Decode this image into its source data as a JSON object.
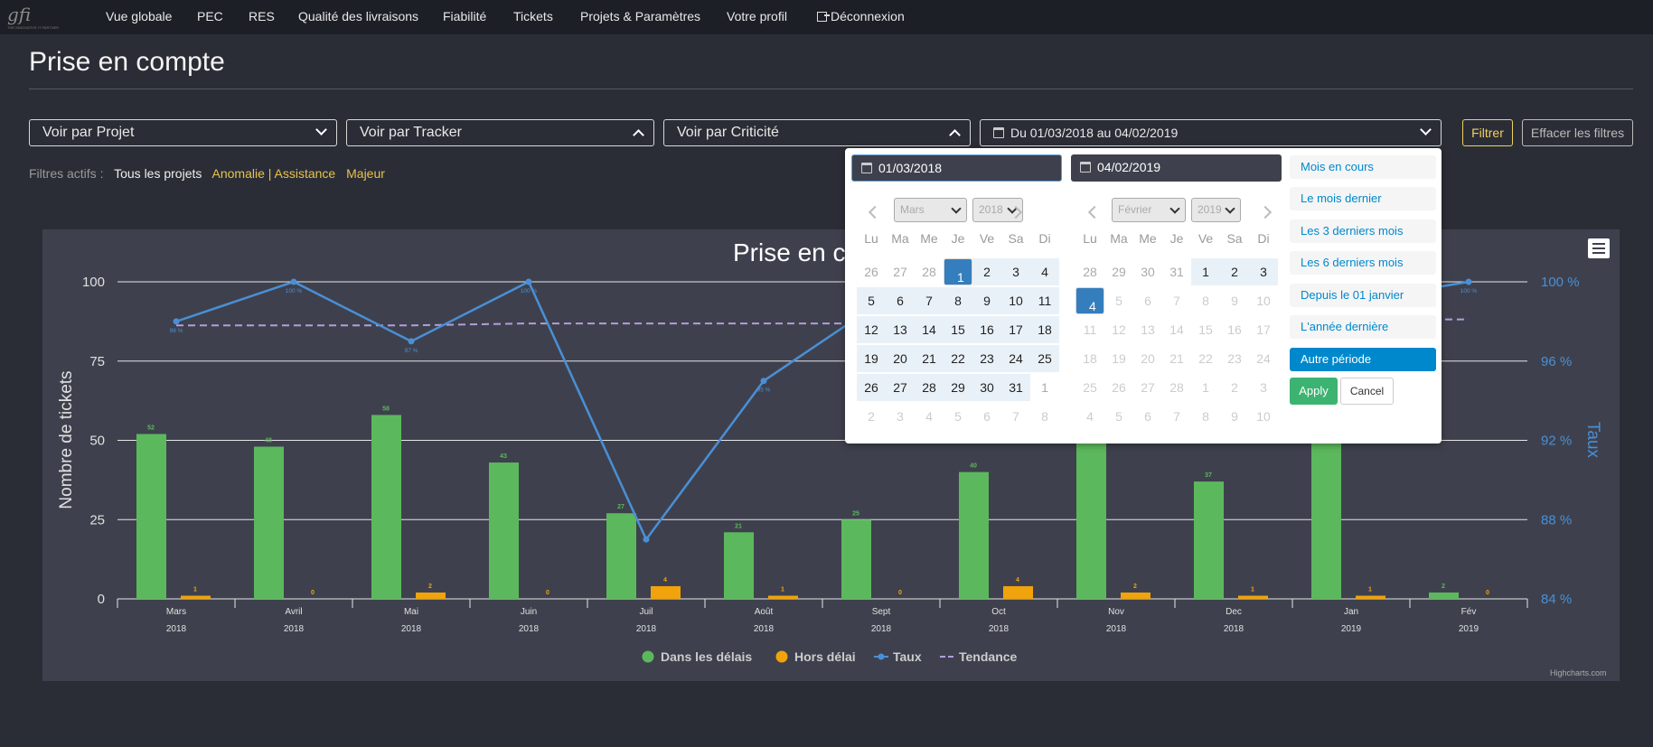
{
  "navbar": {
    "logo_text": "gfi",
    "logo_tagline": "THE INNOVATIVE IT PARTNER",
    "items": [
      "Vue globale",
      "PEC",
      "RES",
      "Qualité des livraisons",
      "Fiabilité",
      "Tickets",
      "Projets & Paramètres",
      "Votre profil",
      "Déconnexion"
    ]
  },
  "page": {
    "title": "Prise en compte"
  },
  "filters": {
    "projet": "Voir par Projet",
    "tracker": "Voir par Tracker",
    "criticite": "Voir par Criticité",
    "date_range": "Du 01/03/2018 au 04/02/2019",
    "filter_button": "Filtrer",
    "clear_button": "Effacer les filtres",
    "active_label": "Filtres actifs :",
    "active": [
      "Tous les projets",
      "Anomalie | Assistance",
      "Majeur"
    ]
  },
  "colors": {
    "green": "#5cb85c",
    "orange": "#f0a30a",
    "blue": "#4a8fd6",
    "trend": "#b39ddb",
    "accent_yellow": "#f0d060"
  },
  "chart_data": {
    "type": "bar",
    "title": "Prise en c",
    "categories": [
      "Mars",
      "Avril",
      "Mai",
      "Juin",
      "Juil",
      "Août",
      "Sept",
      "Oct",
      "Nov",
      "Dec",
      "Jan",
      "Fév"
    ],
    "category_years": [
      "2018",
      "2018",
      "2018",
      "2018",
      "2018",
      "2018",
      "2018",
      "2018",
      "2018",
      "2018",
      "2019",
      "2019"
    ],
    "ylabel": "Nombre de tickets",
    "ylabel_right": "Taux",
    "ylim": [
      0,
      100
    ],
    "yticks": [
      "0",
      "25",
      "50",
      "75",
      "100"
    ],
    "y2ticks": [
      "84 %",
      "88 %",
      "92 %",
      "96 %",
      "100 %"
    ],
    "y2lim": [
      84,
      100
    ],
    "series": [
      {
        "name": "Dans les délais",
        "values": [
          52,
          48,
          58,
          43,
          27,
          21,
          25,
          40,
          55,
          37,
          50,
          2
        ],
        "labels": [
          "52",
          "48",
          "58",
          "43",
          "27",
          "21",
          "25",
          "40",
          "",
          "37",
          "",
          "2"
        ]
      },
      {
        "name": "Hors délai",
        "values": [
          1,
          0,
          2,
          0,
          4,
          1,
          0,
          4,
          2,
          1,
          1,
          0
        ],
        "labels": [
          "1",
          "0",
          "2",
          "0",
          "4",
          "1",
          "0",
          "4",
          "2",
          "1",
          "1",
          "0"
        ]
      },
      {
        "name": "Taux",
        "values": [
          98,
          100,
          97,
          100,
          87,
          95,
          99,
          93,
          100,
          100,
          99,
          100
        ],
        "labels": [
          "98 %",
          "100 %",
          "97 %",
          "100 %",
          "",
          "95 %",
          "",
          "",
          "",
          "",
          "",
          "100 %"
        ]
      },
      {
        "name": "Tendance",
        "values": [
          97.8,
          97.8,
          97.8,
          97.9,
          97.9,
          97.9,
          97.9,
          98.0,
          98.0,
          98.0,
          98.1,
          98.1
        ]
      }
    ],
    "legend_position": "bottom",
    "credits": "Highcharts.com"
  },
  "datepicker": {
    "start_input": "01/03/2018",
    "end_input": "04/02/2019",
    "left_month": "Mars",
    "left_year": "2018",
    "right_month": "Février",
    "right_year": "2019",
    "weekdays": [
      "Lu",
      "Ma",
      "Me",
      "Je",
      "Ve",
      "Sa",
      "Di"
    ],
    "left_days": [
      "26",
      "27",
      "28",
      "1",
      "2",
      "3",
      "4",
      "5",
      "6",
      "7",
      "8",
      "9",
      "10",
      "11",
      "12",
      "13",
      "14",
      "15",
      "16",
      "17",
      "18",
      "19",
      "20",
      "21",
      "22",
      "23",
      "24",
      "25",
      "26",
      "27",
      "28",
      "29",
      "30",
      "31",
      "1",
      "2",
      "3",
      "4",
      "5",
      "6",
      "7",
      "8"
    ],
    "right_days": [
      "28",
      "29",
      "30",
      "31",
      "1",
      "2",
      "3",
      "4",
      "5",
      "6",
      "7",
      "8",
      "9",
      "10",
      "11",
      "12",
      "13",
      "14",
      "15",
      "16",
      "17",
      "18",
      "19",
      "20",
      "21",
      "22",
      "23",
      "24",
      "25",
      "26",
      "27",
      "28",
      "1",
      "2",
      "3",
      "4",
      "5",
      "6",
      "7",
      "8",
      "9",
      "10"
    ],
    "ranges": [
      "Mois en cours",
      "Le mois dernier",
      "Les 3 derniers mois",
      "Les 6 derniers mois",
      "Depuis le 01 janvier",
      "L'année dernière",
      "Autre période"
    ],
    "apply": "Apply",
    "cancel": "Cancel"
  }
}
